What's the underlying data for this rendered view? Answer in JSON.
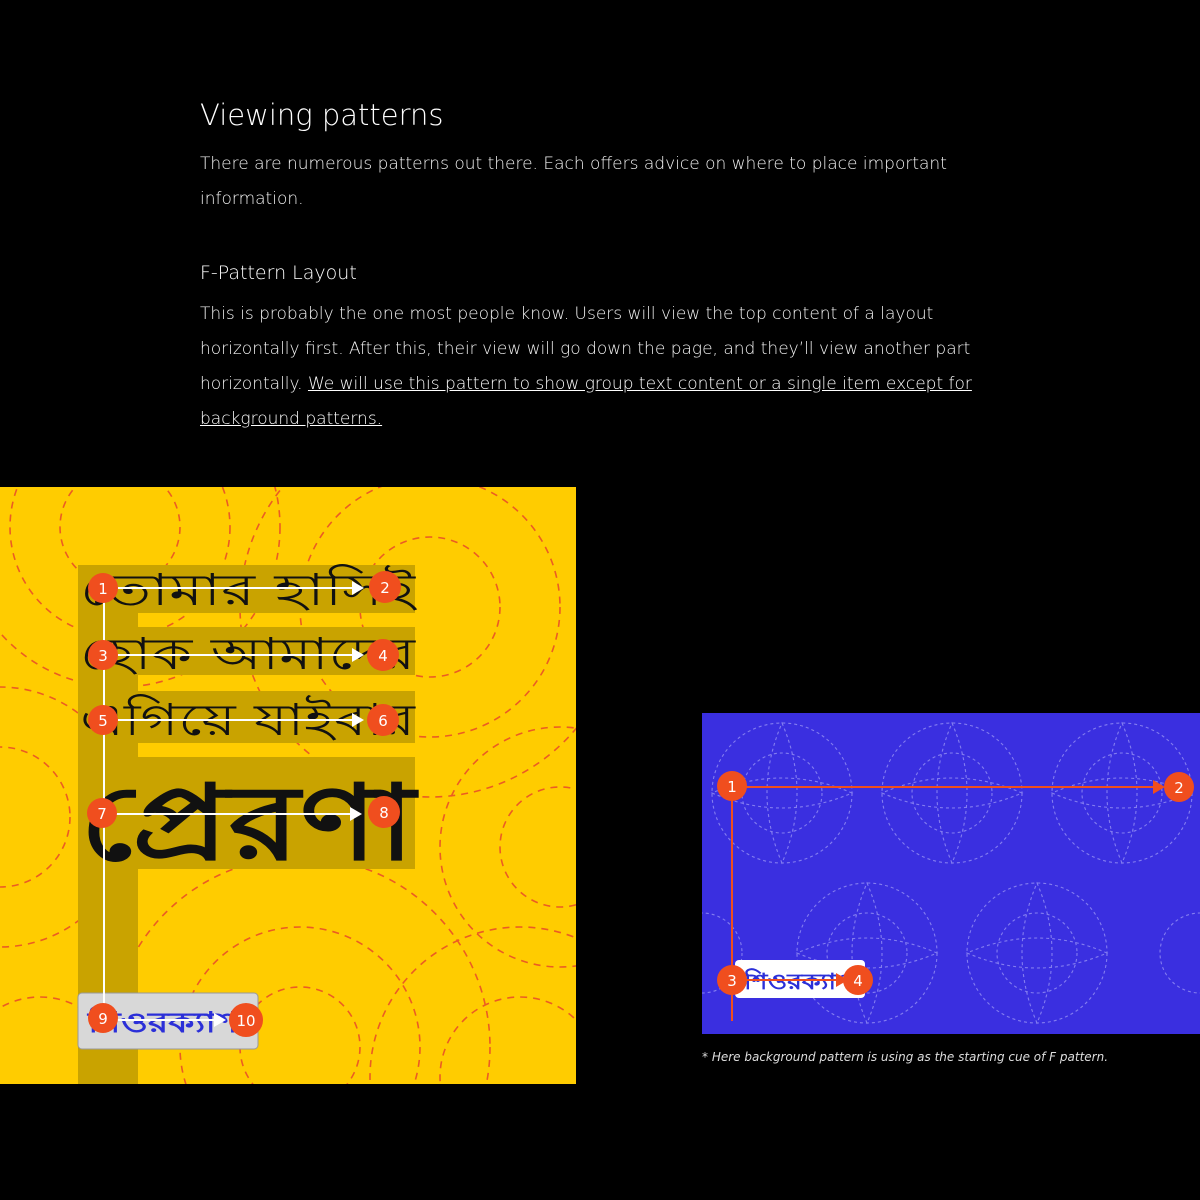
{
  "title": "Viewing patterns",
  "intro": "There are numerous patterns out there. Each offers advice on where to place important information.",
  "section": {
    "heading": "F-Pattern Layout",
    "body": "This is probably the one most people know. Users will view the top content of a layout horizontally first. After this, their view will go down the page, and they’ll view another part horizontally.",
    "link_text": "We will use this pattern to show group text content or a single item except for background patterns."
  },
  "poster_yellow": {
    "lines": [
      "তোমার হাসিই",
      "হোক আমাদের",
      "এগিয়ে যাইবার",
      "প্রেরণা"
    ],
    "logo_text": "শিওরক্যাশ",
    "markers": [
      "1",
      "2",
      "3",
      "4",
      "5",
      "6",
      "7",
      "8",
      "9",
      "10"
    ],
    "colors": {
      "background": "#FFCC00",
      "highlight": "#C9A300",
      "marker": "#F04E1E",
      "dashes": "#E8492A"
    }
  },
  "poster_blue": {
    "logo_text": "শিওরক্যাশ",
    "markers": [
      "1",
      "2",
      "3",
      "4"
    ],
    "colors": {
      "background": "#3A2FE0",
      "marker": "#F04E1E",
      "line": "#F04E1E"
    }
  },
  "caption": "* Here background pattern is using as the starting cue of F pattern."
}
